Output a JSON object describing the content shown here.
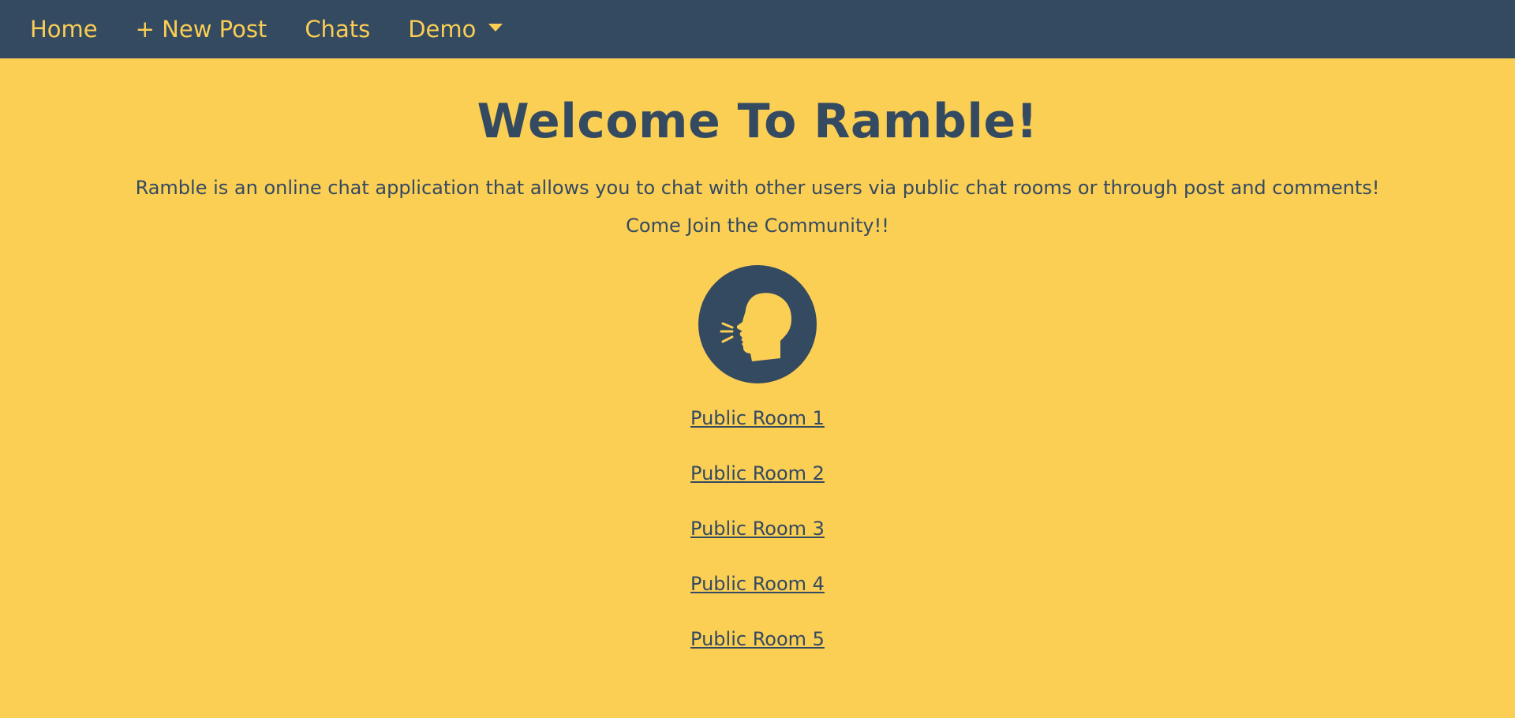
{
  "nav": {
    "home": "Home",
    "new_post": "+ New Post",
    "chats": "Chats",
    "demo": "Demo"
  },
  "main": {
    "title": "Welcome To Ramble!",
    "description": "Ramble is an online chat application that allows you to chat with other users via public chat rooms or through post and comments!",
    "cta": "Come Join the Community!!"
  },
  "logo": {
    "icon": "speaking-head-icon"
  },
  "rooms": [
    "Public Room 1",
    "Public Room 2",
    "Public Room 3",
    "Public Room 4",
    "Public Room 5"
  ],
  "colors": {
    "navbar_bg": "#344a61",
    "page_bg": "#fbce54",
    "text": "#344a61",
    "nav_text": "#fbce54"
  }
}
